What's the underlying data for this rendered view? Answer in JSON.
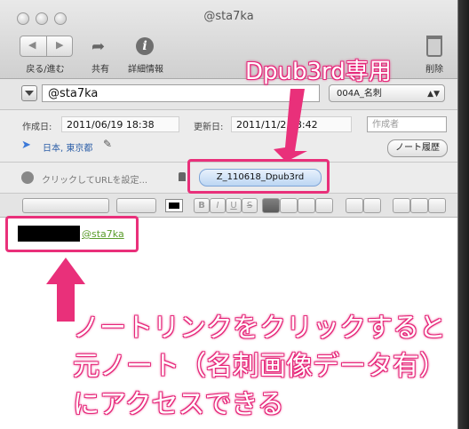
{
  "window": {
    "title": "@sta7ka"
  },
  "toolbar": {
    "back_forward_label": "戻る/進む",
    "share_label": "共有",
    "info_label": "詳細情報",
    "delete_label": "削除"
  },
  "note": {
    "title_value": "@sta7ka",
    "notebook": "004A_名刺",
    "created_label": "作成日:",
    "created_value": "2011/06/19 18:38",
    "updated_label": "更新日:",
    "updated_value": "2011/11/2 18:42",
    "author_placeholder": "作成者",
    "location": "日本, 東京都",
    "history_button": "ノート履歴",
    "url_placeholder": "クリックしてURLを設定...",
    "tag": "Z_110618_Dpub3rd",
    "link_text": "@sta7ka"
  },
  "format_bar": {
    "bold": "B",
    "italic": "I",
    "underline": "U",
    "strike": "S"
  },
  "annotations": {
    "top_callout": "Dpub3rd専用",
    "bottom_callout_line1": "ノートリンクをクリックすると",
    "bottom_callout_line2": "元ノート（名刺画像データ有）",
    "bottom_callout_line3": "にアクセスできる",
    "accent_color": "#e9307a"
  }
}
